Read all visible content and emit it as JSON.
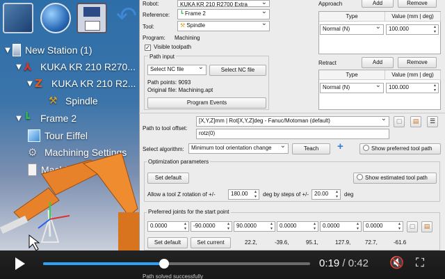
{
  "station_tree": [
    {
      "label": "New Station (1)",
      "icon": "station-icon"
    },
    {
      "label": "KUKA KR 210 R270...",
      "icon": "robot-icon"
    },
    {
      "label": "KUKA KR 210 R2...",
      "icon": "tool-icon"
    },
    {
      "label": "Spindle",
      "icon": "spindle-icon"
    },
    {
      "label": "Frame 2",
      "icon": "frame-icon"
    },
    {
      "label": "Tour Eiffel",
      "icon": "object-icon"
    },
    {
      "label": "Machining Settings",
      "icon": "gear-icon"
    },
    {
      "label": "Machining",
      "icon": "program-icon"
    }
  ],
  "panel": {
    "robot_label": "Robot:",
    "robot_value": "KUKA KR 210 R2700 Extra",
    "reference_label": "Reference:",
    "reference_value": "Frame 2",
    "tool_label": "Tool:",
    "tool_value": "Spindle",
    "program_label": "Program:",
    "program_value": "Machining",
    "visible_toolpath": "Visible toolpath",
    "path_input_title": "Path input",
    "path_input_select": "Select NC file",
    "select_nc_button": "Select NC file",
    "path_points": "Path points: 9093",
    "original_file": "Original file: Machining.apt",
    "program_events_button": "Program Events",
    "approach": {
      "label": "Approach",
      "add": "Add",
      "remove": "Remove",
      "col_type": "Type",
      "col_value": "Value (mm | deg)",
      "row_type": "Normal (N)",
      "row_value": "100.000"
    },
    "retract": {
      "label": "Retract",
      "add": "Add",
      "remove": "Remove",
      "col_type": "Type",
      "col_value": "Value (mm | deg)",
      "row_type": "Normal (N)",
      "row_value": "100.000"
    },
    "path_to_tool_offset_label": "Path to tool offset:",
    "offset_format": "[X,Y,Z]mm | Rot[X,Y,Z]deg - Fanuc/Motoman (default)",
    "offset_value": "rotz(0)",
    "select_algorithm_label": "Select algorithm:",
    "algorithm_value": "Minimum tool orientation change",
    "teach_button": "Teach",
    "plus_label": "+",
    "show_preferred_label": "Show preferred tool path",
    "optimization_title": "Optimization parameters",
    "set_default_button": "Set default",
    "show_estimated_label": "Show estimated tool path",
    "allow_rotation_text": "Allow a tool Z rotation of +/-",
    "rotation_value": "180.00",
    "steps_text": "deg by steps of +/-",
    "steps_value": "20.00",
    "deg_text": "deg",
    "preferred_joints_title": "Preferred joints for the start point",
    "joints": [
      "0.0000",
      "-90.0000",
      "90.0000",
      "0.0000",
      "0.0000",
      "0.0000"
    ],
    "set_default2_button": "Set default",
    "set_current_button": "Set current",
    "joint_readout": [
      "22.2,",
      "-39.6,",
      "95.1,",
      "127.9,",
      "72.7,",
      "-61.6"
    ],
    "bottom_text": "Path solved successfully"
  },
  "player": {
    "current_time": "0:19",
    "separator": "/",
    "duration": "0:42",
    "progress": 0.4524
  },
  "colors": {
    "accent": "#2da2f5",
    "panel_bg": "#ececec",
    "scene_top": "#2e6ea8"
  }
}
